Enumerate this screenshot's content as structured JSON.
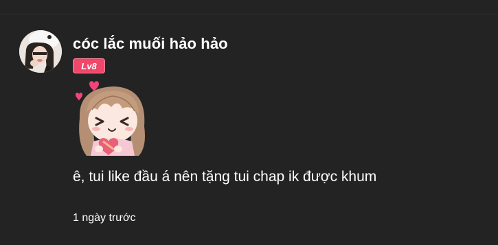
{
  "comment": {
    "username": "cóc lắc muối hảo hảo",
    "level": "Lv8",
    "sticker": "chibi-girl-heart-sticker",
    "text": "ê, tui like đầu á nên tặng tui chap ik được khum",
    "timestamp": "1 ngày trước"
  },
  "colors": {
    "background": "#232323",
    "badge": "#f0476a",
    "text": "#ffffff"
  }
}
